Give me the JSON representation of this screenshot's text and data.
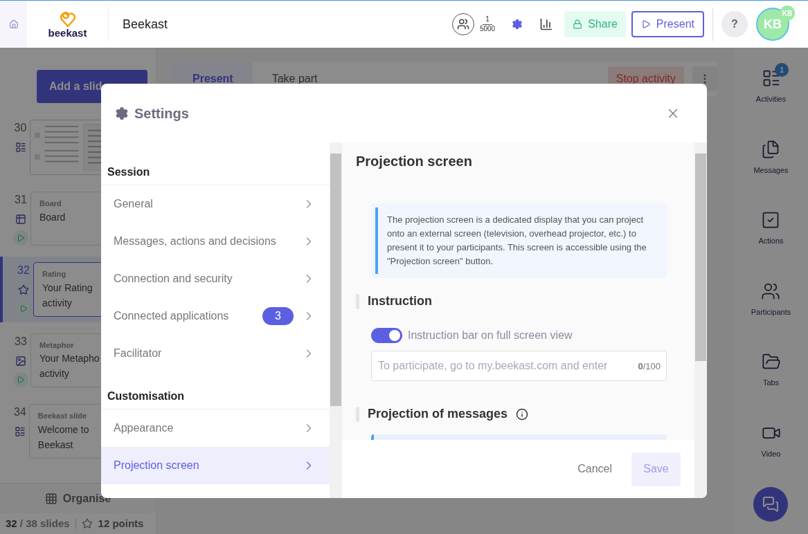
{
  "header": {
    "logo_text": "beekast",
    "title": "Beekast",
    "participants": {
      "count": "1",
      "limit": "5000"
    },
    "share": "Share",
    "present": "Present",
    "help": "?",
    "avatar": "KB",
    "avatar_badge": "KB"
  },
  "sidebar": {
    "add_button": "Add a slid",
    "slides": [
      {
        "number": "30",
        "kind": "thumbnail",
        "selected": false,
        "playable": false
      },
      {
        "number": "31",
        "kind": "card",
        "type": "Board",
        "title": "Board",
        "selected": false,
        "playable": true
      },
      {
        "number": "32",
        "kind": "card",
        "type": "Rating",
        "title": "Your Rating activity",
        "selected": true,
        "playable": true
      },
      {
        "number": "33",
        "kind": "card",
        "type": "Metaphor",
        "title": "Your Metapho activity",
        "selected": false,
        "playable": true
      },
      {
        "number": "34",
        "kind": "card",
        "type": "Beekast slide",
        "title": "Welcome to Beekast",
        "selected": false,
        "playable": false
      }
    ],
    "organise": "Organise",
    "current": "32",
    "total": "/ 38 slides",
    "points": "12 points"
  },
  "center": {
    "tabs": [
      {
        "label": "Present",
        "selected": true
      },
      {
        "label": "Take part",
        "selected": false
      }
    ],
    "stop_button": "Stop activity"
  },
  "rail": [
    {
      "label": "Activities",
      "badge": "1"
    },
    {
      "label": "Messages"
    },
    {
      "label": "Actions"
    },
    {
      "label": "Participants"
    },
    {
      "label": "Tabs"
    },
    {
      "label": "Video"
    }
  ],
  "dialog": {
    "title": "Settings",
    "nav": [
      {
        "title": "Session",
        "items": [
          {
            "label": "General",
            "selected": false
          },
          {
            "label": "Messages, actions and decisions",
            "selected": false
          },
          {
            "label": "Connection and security",
            "selected": false
          },
          {
            "label": "Connected applications",
            "badge": "3",
            "selected": false
          },
          {
            "label": "Facilitator",
            "selected": false
          }
        ]
      },
      {
        "title": "Customisation",
        "items": [
          {
            "label": "Appearance",
            "selected": false
          },
          {
            "label": "Projection screen",
            "selected": true
          }
        ]
      }
    ],
    "content": {
      "title": "Projection screen",
      "info": "The projection screen is a dedicated display that you can project onto an external screen (television, overhead projector, etc.) to present it to your participants. This screen is accessible using the \"Projection screen\" button.",
      "instruction": {
        "heading": "Instruction",
        "toggle_label": "Instruction bar on full screen view",
        "toggle_on": true,
        "placeholder": "To participate, go to my.beekast.com and enter",
        "counter": "**0**/100"
      },
      "messages_heading": "Projection of messages"
    },
    "cancel": "Cancel",
    "save": "Save",
    "save_disabled": true
  }
}
